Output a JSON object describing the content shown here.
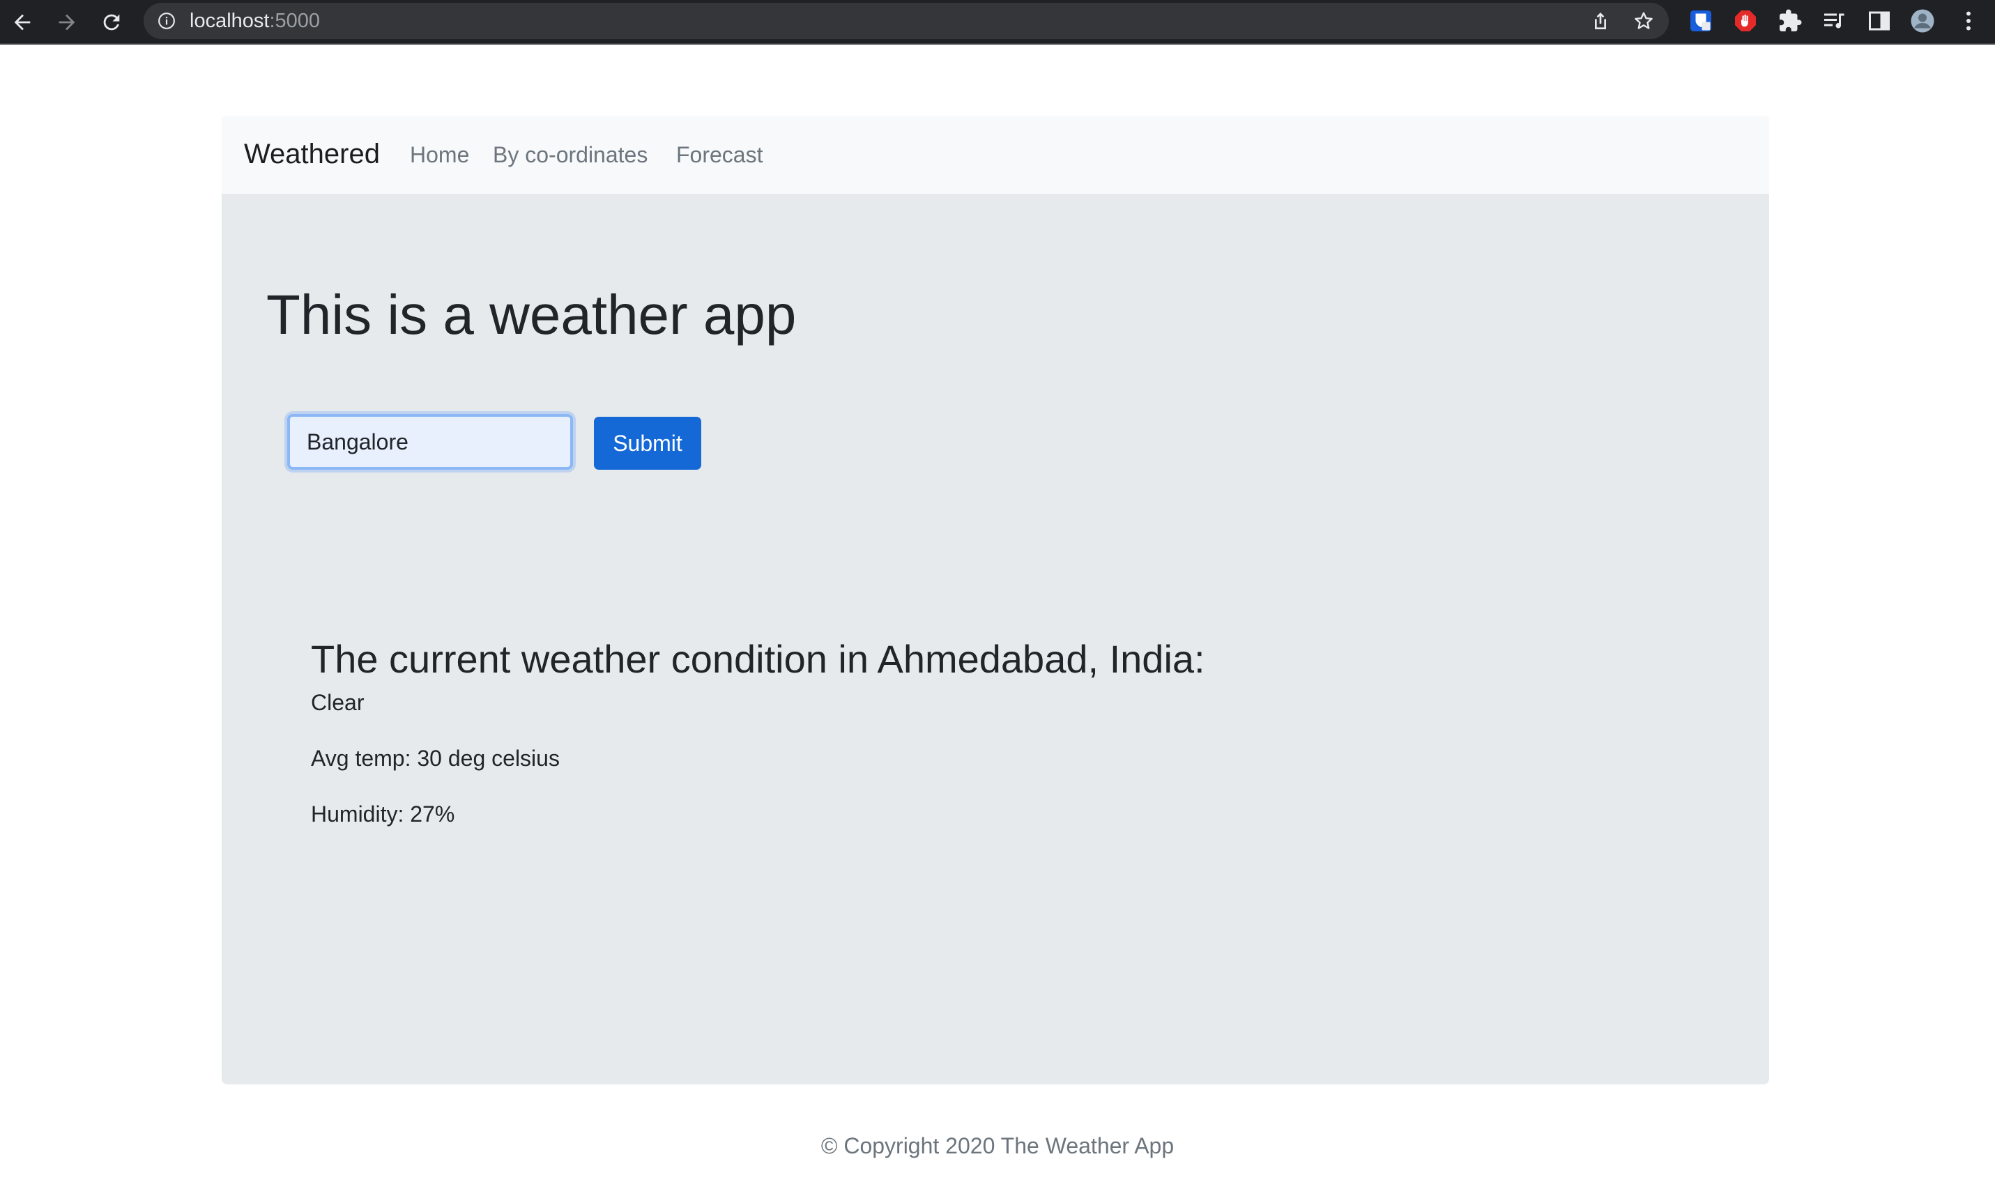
{
  "browser": {
    "url_host": "localhost",
    "url_port": ":5000",
    "icons": {
      "back": "arrow-left-icon",
      "forward": "arrow-right-icon",
      "reload": "reload-icon",
      "info": "info-icon",
      "share": "share-icon",
      "bookmark": "star-icon",
      "extensions": "puzzle-icon",
      "menu": "kebab-menu-icon"
    }
  },
  "navbar": {
    "brand": "Weathered",
    "links": [
      {
        "label": "Home"
      },
      {
        "label": "By co-ordinates"
      },
      {
        "label": "Forecast"
      }
    ]
  },
  "main": {
    "headline": "This is a weather app",
    "search": {
      "value": "Bangalore",
      "submit_label": "Submit"
    },
    "result": {
      "title": "The current weather condition in Ahmedabad, India:",
      "condition": "Clear",
      "temperature": "Avg temp: 30 deg celsius",
      "humidity": "Humidity: 27%"
    }
  },
  "footer": {
    "text": "© Copyright 2020 The Weather App"
  },
  "colors": {
    "accent": "#1469d6",
    "jumbotron_bg": "#e7eaed",
    "navbar_bg": "#f8f9fa",
    "chrome_bg": "#202124"
  }
}
